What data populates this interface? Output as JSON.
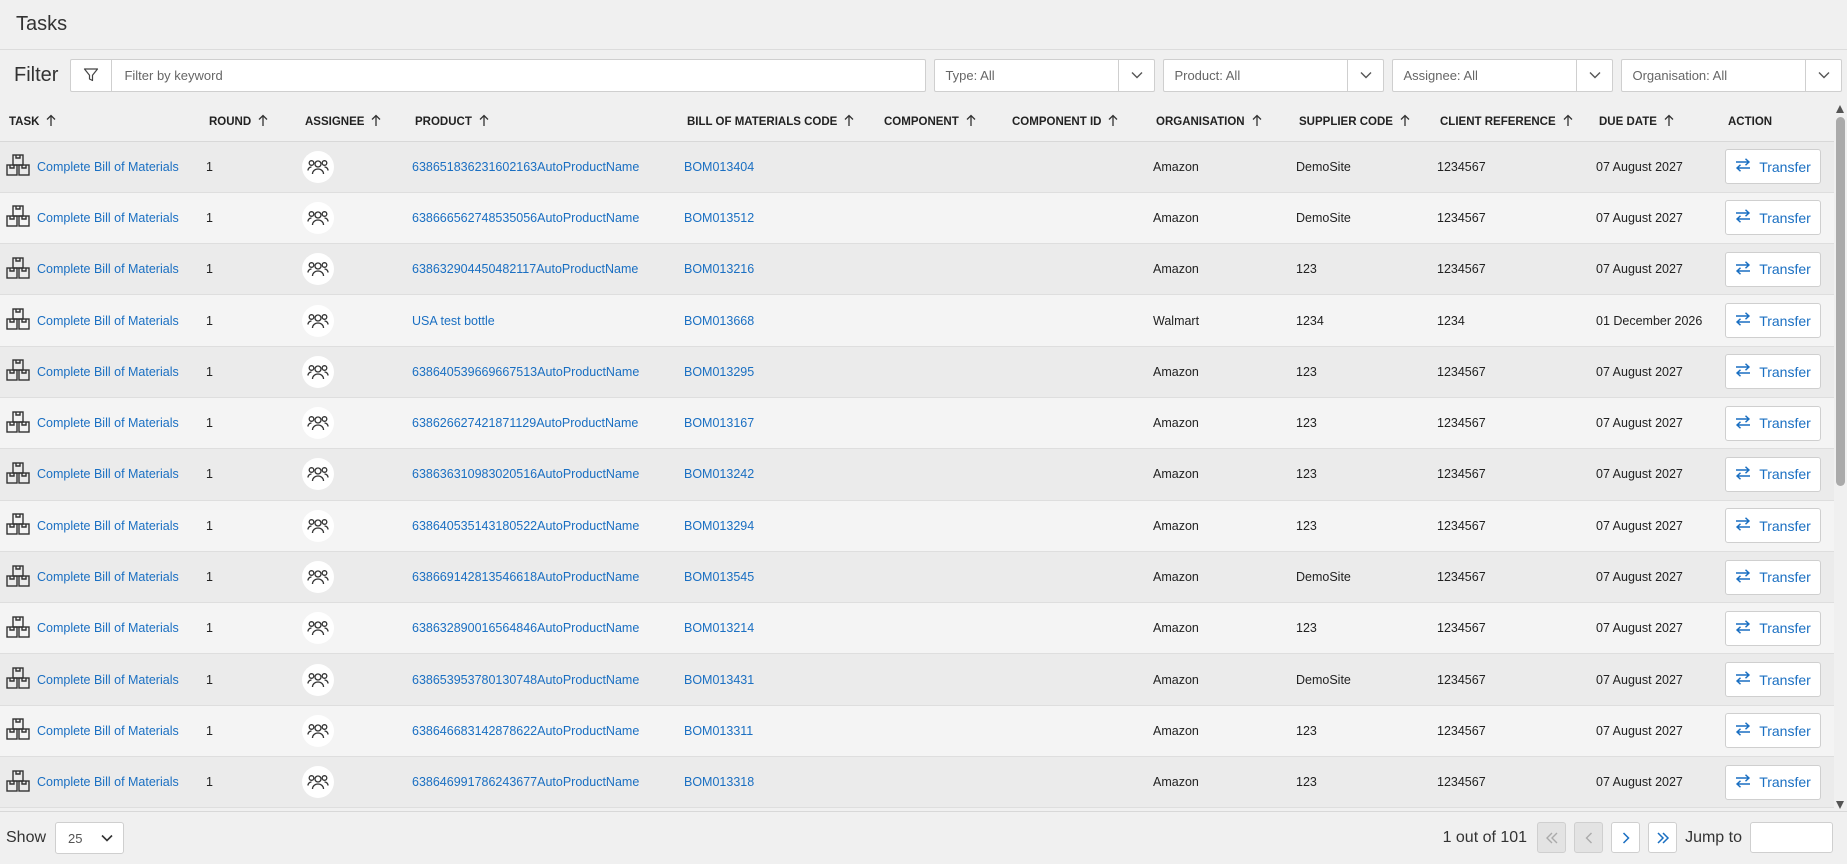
{
  "header": {
    "title": "Tasks"
  },
  "filter": {
    "label": "Filter",
    "keyword_placeholder": "Filter by keyword",
    "type": "Type: All",
    "product": "Product: All",
    "assignee": "Assignee: All",
    "organisation": "Organisation: All"
  },
  "table": {
    "columns": [
      "TASK",
      "ROUND",
      "ASSIGNEE",
      "PRODUCT",
      "BILL OF MATERIALS CODE",
      "COMPONENT",
      "COMPONENT ID",
      "ORGANISATION",
      "SUPPLIER CODE",
      "CLIENT REFERENCE",
      "DUE DATE",
      "ACTION"
    ],
    "action_label": "Transfer",
    "rows": [
      {
        "task": "Complete Bill of Materials",
        "round": "1",
        "product": "638651836231602163AutoProductName",
        "bom": "BOM013404",
        "component": "",
        "component_id": "",
        "organisation": "Amazon",
        "supplier": "DemoSite",
        "client_ref": "1234567",
        "due": "07 August 2027"
      },
      {
        "task": "Complete Bill of Materials",
        "round": "1",
        "product": "638666562748535056AutoProductName",
        "bom": "BOM013512",
        "component": "",
        "component_id": "",
        "organisation": "Amazon",
        "supplier": "DemoSite",
        "client_ref": "1234567",
        "due": "07 August 2027"
      },
      {
        "task": "Complete Bill of Materials",
        "round": "1",
        "product": "638632904450482117AutoProductName",
        "bom": "BOM013216",
        "component": "",
        "component_id": "",
        "organisation": "Amazon",
        "supplier": "123",
        "client_ref": "1234567",
        "due": "07 August 2027"
      },
      {
        "task": "Complete Bill of Materials",
        "round": "1",
        "product": "USA test bottle",
        "bom": "BOM013668",
        "component": "",
        "component_id": "",
        "organisation": "Walmart",
        "supplier": "1234",
        "client_ref": "1234",
        "due": "01 December 2026"
      },
      {
        "task": "Complete Bill of Materials",
        "round": "1",
        "product": "638640539669667513AutoProductName",
        "bom": "BOM013295",
        "component": "",
        "component_id": "",
        "organisation": "Amazon",
        "supplier": "123",
        "client_ref": "1234567",
        "due": "07 August 2027"
      },
      {
        "task": "Complete Bill of Materials",
        "round": "1",
        "product": "638626627421871129AutoProductName",
        "bom": "BOM013167",
        "component": "",
        "component_id": "",
        "organisation": "Amazon",
        "supplier": "123",
        "client_ref": "1234567",
        "due": "07 August 2027"
      },
      {
        "task": "Complete Bill of Materials",
        "round": "1",
        "product": "638636310983020516AutoProductName",
        "bom": "BOM013242",
        "component": "",
        "component_id": "",
        "organisation": "Amazon",
        "supplier": "123",
        "client_ref": "1234567",
        "due": "07 August 2027"
      },
      {
        "task": "Complete Bill of Materials",
        "round": "1",
        "product": "638640535143180522AutoProductName",
        "bom": "BOM013294",
        "component": "",
        "component_id": "",
        "organisation": "Amazon",
        "supplier": "123",
        "client_ref": "1234567",
        "due": "07 August 2027"
      },
      {
        "task": "Complete Bill of Materials",
        "round": "1",
        "product": "638669142813546618AutoProductName",
        "bom": "BOM013545",
        "component": "",
        "component_id": "",
        "organisation": "Amazon",
        "supplier": "DemoSite",
        "client_ref": "1234567",
        "due": "07 August 2027"
      },
      {
        "task": "Complete Bill of Materials",
        "round": "1",
        "product": "638632890016564846AutoProductName",
        "bom": "BOM013214",
        "component": "",
        "component_id": "",
        "organisation": "Amazon",
        "supplier": "123",
        "client_ref": "1234567",
        "due": "07 August 2027"
      },
      {
        "task": "Complete Bill of Materials",
        "round": "1",
        "product": "638653953780130748AutoProductName",
        "bom": "BOM013431",
        "component": "",
        "component_id": "",
        "organisation": "Amazon",
        "supplier": "DemoSite",
        "client_ref": "1234567",
        "due": "07 August 2027"
      },
      {
        "task": "Complete Bill of Materials",
        "round": "1",
        "product": "638646683142878622AutoProductName",
        "bom": "BOM013311",
        "component": "",
        "component_id": "",
        "organisation": "Amazon",
        "supplier": "123",
        "client_ref": "1234567",
        "due": "07 August 2027"
      },
      {
        "task": "Complete Bill of Materials",
        "round": "1",
        "product": "638646991786243677AutoProductName",
        "bom": "BOM013318",
        "component": "",
        "component_id": "",
        "organisation": "Amazon",
        "supplier": "123",
        "client_ref": "1234567",
        "due": "07 August 2027"
      }
    ]
  },
  "footer": {
    "show_label": "Show",
    "page_size": "25",
    "page_info": "1 out of 101",
    "jump_label": "Jump to"
  },
  "colors": {
    "link": "#1a6fc2",
    "row_odd": "#ebebeb",
    "row_even": "#f4f4f4"
  }
}
